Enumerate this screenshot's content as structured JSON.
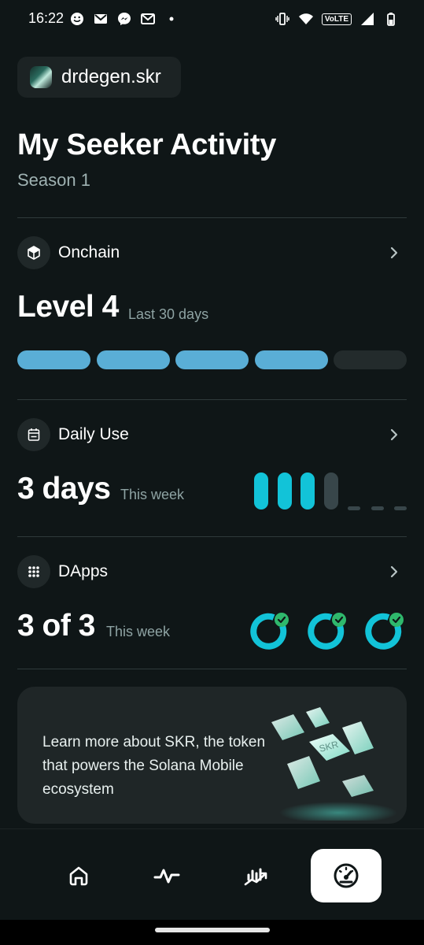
{
  "status_bar": {
    "time": "16:22",
    "volte_label": "VoLTE"
  },
  "profile": {
    "name": "drdegen.skr"
  },
  "header": {
    "title": "My Seeker Activity",
    "subtitle": "Season 1"
  },
  "onchain": {
    "label": "Onchain",
    "value": "Level 4",
    "period": "Last 30 days",
    "level": 4,
    "max_level": 5
  },
  "daily_use": {
    "label": "Daily Use",
    "value": "3 days",
    "period": "This week"
  },
  "dapps": {
    "label": "DApps",
    "value": "3 of 3",
    "period": "This week",
    "completed": 3,
    "total": 3
  },
  "promo": {
    "text": "Learn more about SKR, the token that powers the Solana Mobile ecosystem",
    "art_label": "SKR"
  },
  "nav": {
    "items": [
      "home-icon",
      "activity-icon",
      "trending-icon",
      "gauge-icon"
    ],
    "active_index": 3
  },
  "colors": {
    "background": "#0f1617",
    "card": "#1f2627",
    "level_fill": "#5aaed6",
    "daily_active": "#12c3d8",
    "check_green": "#2fb86c",
    "muted_text": "#8ea3a3"
  }
}
